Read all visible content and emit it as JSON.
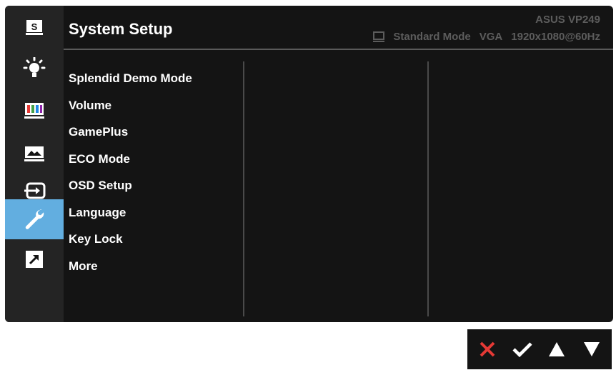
{
  "header": {
    "title": "System Setup",
    "model": "ASUS  VP249",
    "mode": "Standard Mode",
    "input": "VGA",
    "resolution": "1920x1080@60Hz"
  },
  "sidebar": {
    "items": [
      {
        "icon": "splendid-s-icon",
        "label": "S",
        "active": false
      },
      {
        "icon": "blue-light-filter-icon",
        "active": false
      },
      {
        "icon": "color-icon",
        "active": false
      },
      {
        "icon": "image-icon",
        "active": false
      },
      {
        "icon": "input-select-icon",
        "active": false
      },
      {
        "icon": "wrench-icon",
        "active": true
      },
      {
        "icon": "shortcut-icon",
        "active": false
      }
    ]
  },
  "menu": {
    "items": [
      "Splendid Demo Mode",
      "Volume",
      "GamePlus",
      "ECO Mode",
      "OSD Setup",
      "Language",
      "Key Lock",
      "More"
    ]
  },
  "keys": [
    {
      "icon": "close-icon",
      "color": "#e53935"
    },
    {
      "icon": "checkmark-icon",
      "color": "#ffffff"
    },
    {
      "icon": "up-arrow-icon",
      "color": "#ffffff"
    },
    {
      "icon": "down-arrow-icon",
      "color": "#ffffff"
    }
  ],
  "colors": {
    "accent": "#62aee0",
    "background": "#141414",
    "sidebar": "#242424"
  }
}
